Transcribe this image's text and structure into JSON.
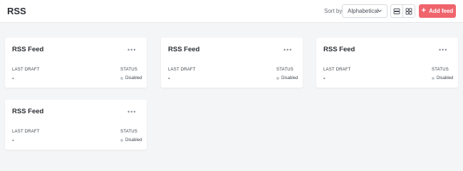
{
  "header": {
    "title": "RSS",
    "sort_label": "Sort by",
    "sort_value": "Alphabetical",
    "add_label": "Add feed",
    "accent_color": "#f0646c"
  },
  "icons": {
    "sort_chevron": "chevron-down-icon",
    "list_view": "list-view-icon",
    "grid_view": "grid-view-icon",
    "add": "plus-icon",
    "card_menu": "more-horizontal-icon"
  },
  "cards": [
    {
      "title": "RSS Feed",
      "menu": "•••",
      "draft_label": "LAST DRAFT",
      "draft_value": "-",
      "status_label": "STATUS",
      "status_value": "Disabled"
    },
    {
      "title": "RSS Feed",
      "menu": "•••",
      "draft_label": "LAST DRAFT",
      "draft_value": "-",
      "status_label": "STATUS",
      "status_value": "Disabled"
    },
    {
      "title": "RSS Feed",
      "menu": "•••",
      "draft_label": "LAST DRAFT",
      "draft_value": "-",
      "status_label": "STATUS",
      "status_value": "Disabled"
    },
    {
      "title": "RSS Feed",
      "menu": "•••",
      "draft_label": "LAST DRAFT",
      "draft_value": "-",
      "status_label": "STATUS",
      "status_value": "Disabled"
    }
  ]
}
